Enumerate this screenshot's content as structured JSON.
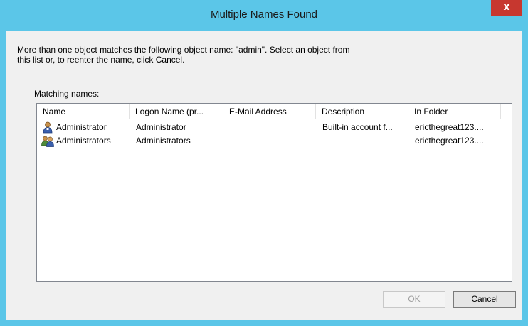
{
  "window": {
    "title": "Multiple Names Found",
    "close_glyph": "x"
  },
  "message": "More than one object matches the following object name: \"admin\". Select an object from this list or, to reenter the name, click Cancel.",
  "matching_label": "Matching names:",
  "columns": [
    "Name",
    "Logon Name (pr...",
    "E-Mail Address",
    "Description",
    "In Folder"
  ],
  "rows": [
    {
      "icon": "user-icon",
      "name": "Administrator",
      "logon_name": "Administrator",
      "email": "",
      "description": "Built-in account f...",
      "folder": "ericthegreat123...."
    },
    {
      "icon": "group-icon",
      "name": "Administrators",
      "logon_name": "Administrators",
      "email": "",
      "description": "",
      "folder": "ericthegreat123...."
    }
  ],
  "buttons": {
    "ok_label": "OK",
    "cancel_label": "Cancel"
  },
  "colors": {
    "titlebar": "#5bc6e8",
    "close_button": "#c7372f",
    "client_background": "#f0f0f0"
  }
}
